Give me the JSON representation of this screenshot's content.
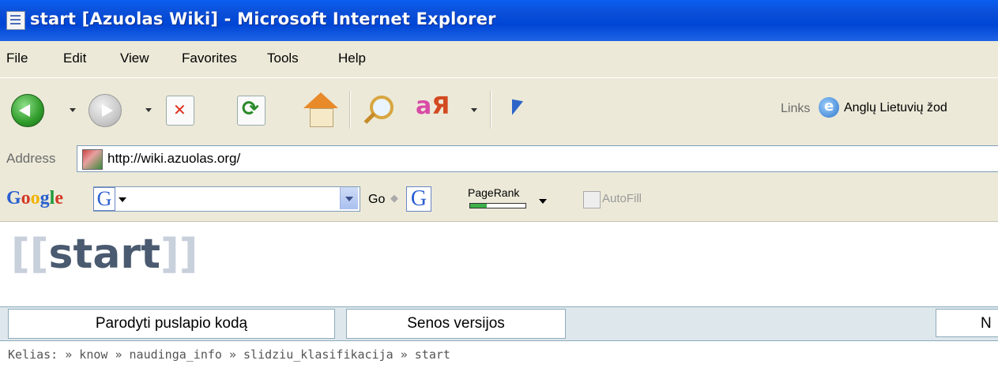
{
  "window": {
    "title": "start [Azuolas Wiki] - Microsoft Internet Explorer"
  },
  "menu": {
    "items": [
      "File",
      "Edit",
      "View",
      "Favorites",
      "Tools",
      "Help"
    ]
  },
  "toolbar": {
    "links_label": "Links",
    "links_item": "Anglų Lietuvių žod"
  },
  "address": {
    "label": "Address",
    "url": "http://wiki.azuolas.org/"
  },
  "google": {
    "logo": "Google",
    "go_label": "Go",
    "pagerank_label": "PageRank",
    "pagerank_fraction": 0.3,
    "autofill_label": "AutoFill",
    "g_glyph": "G"
  },
  "page": {
    "title_open": "[[",
    "title_word": "start",
    "title_close": "]]",
    "buttons": [
      "Parodyti puslapio kodą",
      "Senos versijos",
      "N"
    ],
    "breadcrumb": "Kelias: » know » naudinga_info » slidziu_klasifikacija » start"
  },
  "colors": {
    "titlebar": "#0046d5",
    "chrome": "#ece9d8",
    "wiki_bar": "#dee7ec"
  }
}
